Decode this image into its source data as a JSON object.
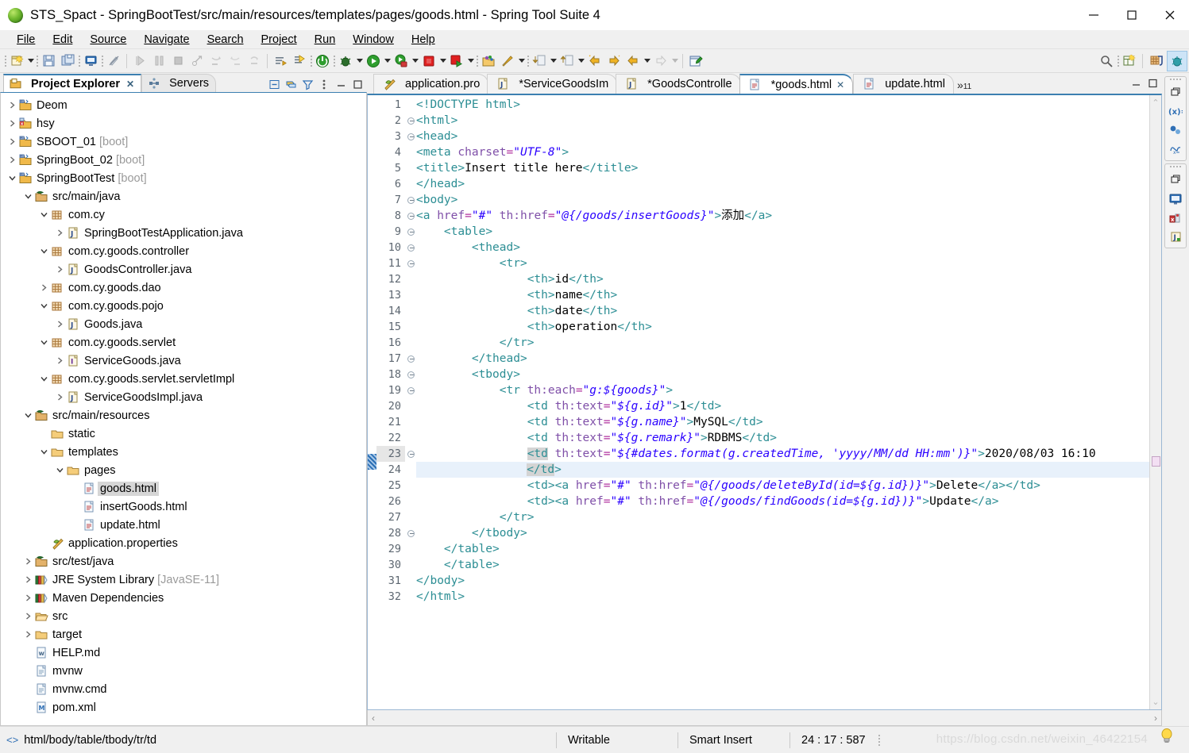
{
  "window": {
    "title": "STS_Spact - SpringBootTest/src/main/resources/templates/pages/goods.html - Spring Tool Suite 4",
    "controls": {
      "minimize": "minimize-button",
      "maximize": "maximize-button",
      "close": "close-button"
    }
  },
  "menubar": {
    "items": [
      {
        "label": "File",
        "mnemonic": "F"
      },
      {
        "label": "Edit",
        "mnemonic": "E"
      },
      {
        "label": "Source",
        "mnemonic": "S"
      },
      {
        "label": "Navigate",
        "mnemonic": "N"
      },
      {
        "label": "Search",
        "mnemonic": "c"
      },
      {
        "label": "Project",
        "mnemonic": "P"
      },
      {
        "label": "Run",
        "mnemonic": "R"
      },
      {
        "label": "Window",
        "mnemonic": "W"
      },
      {
        "label": "Help",
        "mnemonic": "H"
      }
    ]
  },
  "toolbar": {
    "buttons": [
      "new-wizard-icon",
      "save-icon",
      "save-all-icon",
      "open-console-icon",
      "toggle-mark-occurrences-icon",
      "run-last-tool-icon",
      "step-over-icon",
      "terminate-icon",
      "skip-breakpoints-icon",
      "step-into-icon",
      "step-return-icon",
      "drop-to-frame-icon",
      "next-annotation-icon",
      "boot-dashboard-icon",
      "live-hover-icon",
      "debug-icon",
      "run-icon",
      "run-as-spring-icon",
      "stop-icon",
      "relaunch-icon",
      "new-java-package-icon",
      "new-java-class-icon",
      "open-type-icon",
      "open-task-icon",
      "back-icon",
      "forward-icon",
      "previous-edit-icon",
      "next-edit-icon",
      "new-editor-icon"
    ],
    "right_buttons": [
      "search-icon",
      "new-dialog-icon",
      "java-perspective-icon",
      "spring-perspective-icon"
    ]
  },
  "explorer": {
    "tabs": [
      {
        "label": "Project Explorer",
        "icon": "project-explorer-icon",
        "active": true,
        "closeable": true
      },
      {
        "label": "Servers",
        "icon": "servers-icon",
        "active": false,
        "closeable": false
      }
    ],
    "view_toolbar": [
      "collapse-all-icon",
      "link-with-editor-icon",
      "filter-icon",
      "view-menu-icon",
      "minimize-icon",
      "maximize-icon"
    ],
    "tree": [
      {
        "indent": 0,
        "twisty": "collapsed",
        "icon": "project-icon",
        "label": "Deom",
        "suffix": ""
      },
      {
        "indent": 0,
        "twisty": "collapsed",
        "icon": "project-error-icon",
        "label": "hsy",
        "suffix": ""
      },
      {
        "indent": 0,
        "twisty": "collapsed",
        "icon": "project-icon",
        "label": "SBOOT_01",
        "suffix": "[boot]"
      },
      {
        "indent": 0,
        "twisty": "collapsed",
        "icon": "project-icon",
        "label": "SpringBoot_02",
        "suffix": "[boot]"
      },
      {
        "indent": 0,
        "twisty": "expanded",
        "icon": "project-icon",
        "label": "SpringBootTest",
        "suffix": "[boot]"
      },
      {
        "indent": 1,
        "twisty": "expanded",
        "icon": "source-folder-icon",
        "label": "src/main/java",
        "suffix": ""
      },
      {
        "indent": 2,
        "twisty": "expanded",
        "icon": "package-icon",
        "label": "com.cy",
        "suffix": ""
      },
      {
        "indent": 3,
        "twisty": "collapsed",
        "icon": "java-file-icon",
        "label": "SpringBootTestApplication.java",
        "suffix": ""
      },
      {
        "indent": 2,
        "twisty": "expanded",
        "icon": "package-icon",
        "label": "com.cy.goods.controller",
        "suffix": ""
      },
      {
        "indent": 3,
        "twisty": "collapsed",
        "icon": "java-file-icon",
        "label": "GoodsController.java",
        "suffix": ""
      },
      {
        "indent": 2,
        "twisty": "collapsed",
        "icon": "package-icon",
        "label": "com.cy.goods.dao",
        "suffix": ""
      },
      {
        "indent": 2,
        "twisty": "expanded",
        "icon": "package-icon",
        "label": "com.cy.goods.pojo",
        "suffix": ""
      },
      {
        "indent": 3,
        "twisty": "collapsed",
        "icon": "java-file-icon",
        "label": "Goods.java",
        "suffix": ""
      },
      {
        "indent": 2,
        "twisty": "expanded",
        "icon": "package-icon",
        "label": "com.cy.goods.servlet",
        "suffix": ""
      },
      {
        "indent": 3,
        "twisty": "collapsed",
        "icon": "java-interface-icon",
        "label": "ServiceGoods.java",
        "suffix": ""
      },
      {
        "indent": 2,
        "twisty": "expanded",
        "icon": "package-icon",
        "label": "com.cy.goods.servlet.servletImpl",
        "suffix": ""
      },
      {
        "indent": 3,
        "twisty": "collapsed",
        "icon": "java-file-icon",
        "label": "ServiceGoodsImpl.java",
        "suffix": ""
      },
      {
        "indent": 1,
        "twisty": "expanded",
        "icon": "source-folder-icon",
        "label": "src/main/resources",
        "suffix": ""
      },
      {
        "indent": 2,
        "twisty": "none",
        "icon": "folder-icon",
        "label": "static",
        "suffix": ""
      },
      {
        "indent": 2,
        "twisty": "expanded",
        "icon": "folder-icon",
        "label": "templates",
        "suffix": ""
      },
      {
        "indent": 3,
        "twisty": "expanded",
        "icon": "folder-icon",
        "label": "pages",
        "suffix": ""
      },
      {
        "indent": 4,
        "twisty": "none",
        "icon": "html-file-icon",
        "label": "goods.html",
        "suffix": "",
        "selected": true
      },
      {
        "indent": 4,
        "twisty": "none",
        "icon": "html-file-icon",
        "label": "insertGoods.html",
        "suffix": ""
      },
      {
        "indent": 4,
        "twisty": "none",
        "icon": "html-file-icon",
        "label": "update.html",
        "suffix": ""
      },
      {
        "indent": 2,
        "twisty": "none",
        "icon": "properties-file-icon",
        "label": "application.properties",
        "suffix": ""
      },
      {
        "indent": 1,
        "twisty": "collapsed",
        "icon": "source-folder-icon",
        "label": "src/test/java",
        "suffix": ""
      },
      {
        "indent": 1,
        "twisty": "collapsed",
        "icon": "library-icon",
        "label": "JRE System Library",
        "suffix": "[JavaSE-11]"
      },
      {
        "indent": 1,
        "twisty": "collapsed",
        "icon": "library-icon",
        "label": "Maven Dependencies",
        "suffix": ""
      },
      {
        "indent": 1,
        "twisty": "collapsed",
        "icon": "folder-open-icon",
        "label": "src",
        "suffix": ""
      },
      {
        "indent": 1,
        "twisty": "collapsed",
        "icon": "folder-icon",
        "label": "target",
        "suffix": ""
      },
      {
        "indent": 1,
        "twisty": "none",
        "icon": "markdown-file-icon",
        "label": "HELP.md",
        "suffix": ""
      },
      {
        "indent": 1,
        "twisty": "none",
        "icon": "text-file-icon",
        "label": "mvnw",
        "suffix": ""
      },
      {
        "indent": 1,
        "twisty": "none",
        "icon": "text-file-icon",
        "label": "mvnw.cmd",
        "suffix": ""
      },
      {
        "indent": 1,
        "twisty": "none",
        "icon": "xml-file-icon",
        "label": "pom.xml",
        "suffix": ""
      }
    ]
  },
  "editor": {
    "tabs": [
      {
        "label": "application.pro",
        "icon": "properties-file-icon",
        "active": false,
        "closeable": false,
        "dirty": false
      },
      {
        "label": "*ServiceGoodsIm",
        "icon": "java-file-icon",
        "active": false,
        "closeable": false,
        "dirty": true
      },
      {
        "label": "*GoodsControlle",
        "icon": "java-file-icon",
        "active": false,
        "closeable": false,
        "dirty": true
      },
      {
        "label": "*goods.html",
        "icon": "html-file-icon",
        "active": true,
        "closeable": true,
        "dirty": true
      },
      {
        "label": "update.html",
        "icon": "html-file-icon",
        "active": false,
        "closeable": false,
        "dirty": false
      }
    ],
    "overflow_label": "»",
    "overflow_count": "11",
    "first_line": 1,
    "total_lines": 32,
    "cursor_line": 24,
    "highlighted_line": 23,
    "folded_lines": [
      2,
      3,
      7,
      8,
      9,
      10,
      11,
      17,
      18,
      19,
      23,
      28
    ],
    "lines": [
      {
        "n": 1,
        "text": "<!DOCTYPE html>"
      },
      {
        "n": 2,
        "text": "<html>"
      },
      {
        "n": 3,
        "text": "<head>"
      },
      {
        "n": 4,
        "text": "<meta charset=\"UTF-8\">"
      },
      {
        "n": 5,
        "text": "<title>Insert title here</title>"
      },
      {
        "n": 6,
        "text": "</head>"
      },
      {
        "n": 7,
        "text": "<body>"
      },
      {
        "n": 8,
        "text": "<a href=\"#\" th:href=\"@{/goods/insertGoods}\">添加</a>"
      },
      {
        "n": 9,
        "text": "    <table>"
      },
      {
        "n": 10,
        "text": "        <thead>"
      },
      {
        "n": 11,
        "text": "            <tr>"
      },
      {
        "n": 12,
        "text": "                <th>id</th>"
      },
      {
        "n": 13,
        "text": "                <th>name</th>"
      },
      {
        "n": 14,
        "text": "                <th>date</th>"
      },
      {
        "n": 15,
        "text": "                <th>operation</th>"
      },
      {
        "n": 16,
        "text": "            </tr>"
      },
      {
        "n": 17,
        "text": "        </thead>"
      },
      {
        "n": 18,
        "text": "        <tbody>"
      },
      {
        "n": 19,
        "text": "            <tr th:each=\"g:${goods}\">"
      },
      {
        "n": 20,
        "text": "                <td th:text=\"${g.id}\">1</td>"
      },
      {
        "n": 21,
        "text": "                <td th:text=\"${g.name}\">MySQL</td>"
      },
      {
        "n": 22,
        "text": "                <td th:text=\"${g.remark}\">RDBMS</td>"
      },
      {
        "n": 23,
        "text": "                <td th:text=\"${#dates.format(g.createdTime, 'yyyy/MM/dd HH:mm')}\">2020/08/03 16:10"
      },
      {
        "n": 24,
        "text": "                </td>"
      },
      {
        "n": 25,
        "text": "                <td><a href=\"#\" th:href=\"@{/goods/deleteById(id=${g.id})}\">Delete</a></td>"
      },
      {
        "n": 26,
        "text": "                <td><a href=\"#\" th:href=\"@{/goods/findGoods(id=${g.id})}\">Update</a>"
      },
      {
        "n": 27,
        "text": "            </tr>"
      },
      {
        "n": 28,
        "text": "        </tbody>"
      },
      {
        "n": 29,
        "text": "    </table>"
      },
      {
        "n": 30,
        "text": "    </table>"
      },
      {
        "n": 31,
        "text": "</body>"
      },
      {
        "n": 32,
        "text": "</html>"
      }
    ]
  },
  "dock": {
    "groups": [
      [
        "restore-icon",
        "variables-icon",
        "breakpoints-icon",
        "expressions-icon"
      ],
      [
        "restore-icon",
        "console-icon",
        "problems-icon",
        "javadoc-icon"
      ]
    ]
  },
  "statusbar": {
    "breadcrumb_icon": "code-tag-icon",
    "breadcrumb": "html/body/table/tbody/tr/td",
    "writable": "Writable",
    "insert_mode": "Smart Insert",
    "position": "24 : 17 : 587",
    "watermark": "https://blog.csdn.net/weixin_46422154",
    "quick_fix_icon": "lightbulb-icon"
  }
}
